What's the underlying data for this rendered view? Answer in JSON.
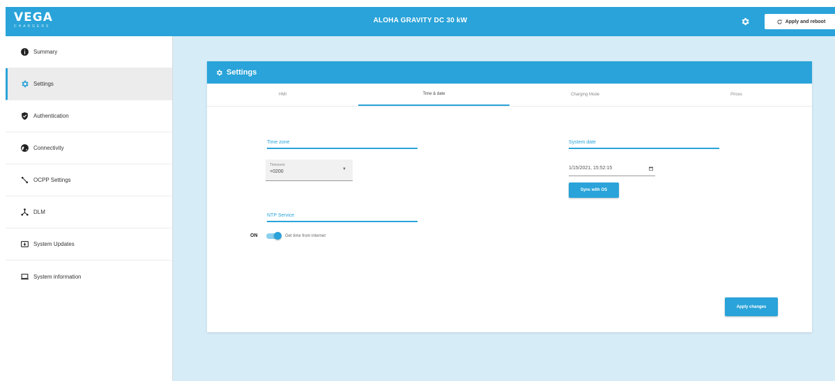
{
  "header": {
    "logo_main": "VEGA",
    "logo_sub": "CHARGERS",
    "device_title": "ALOHA GRAVITY DC 30 kW",
    "apply_reboot_label": "Apply and reboot"
  },
  "sidebar": {
    "items": [
      {
        "label": "Summary",
        "icon": "info-icon"
      },
      {
        "label": "Settings",
        "icon": "gear-icon"
      },
      {
        "label": "Authentication",
        "icon": "shield-check-icon"
      },
      {
        "label": "Connectivity",
        "icon": "globe-icon"
      },
      {
        "label": "OCPP Settings",
        "icon": "ocpp-icon"
      },
      {
        "label": "DLM",
        "icon": "network-icon"
      },
      {
        "label": "System Updates",
        "icon": "update-icon"
      },
      {
        "label": "System information",
        "icon": "laptop-icon"
      }
    ]
  },
  "settings": {
    "title": "Settings",
    "tabs": [
      "HMI",
      "Time & date",
      "Charging Mode",
      "Prices"
    ],
    "active_tab": "Time & date",
    "time_zone": {
      "label": "Time zone",
      "select_caption": "Timezone",
      "select_value": "+0200"
    },
    "system_date": {
      "label": "System date",
      "value": "1/15/2021, 15:52:15",
      "sync_button": "Sync with OS"
    },
    "ntp": {
      "label": "NTP Service",
      "state_label": "ON",
      "toggle_on": true,
      "toggle_text": "Get time from internet"
    },
    "apply_button": "Apply changes"
  },
  "colors": {
    "accent": "#29a3d9",
    "content_bg": "#d6ecf7",
    "active_sidebar_bg": "#ececec"
  }
}
